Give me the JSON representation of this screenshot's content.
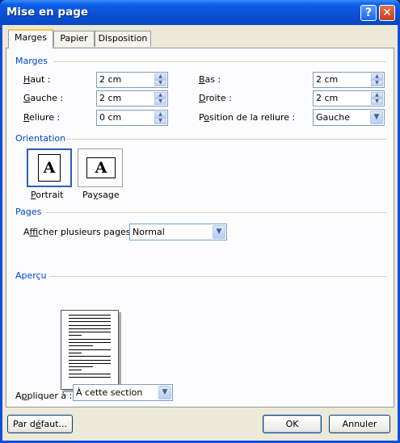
{
  "window": {
    "title": "Mise en page",
    "help_glyph": "?",
    "close_glyph": "✕"
  },
  "tabs": [
    {
      "label": "Marges",
      "active": true
    },
    {
      "label": "Papier",
      "active": false
    },
    {
      "label": "Disposition",
      "active": false
    }
  ],
  "margins": {
    "group_label": "Marges",
    "haut": {
      "mnemonic": "H",
      "rest": "aut :",
      "value": "2 cm"
    },
    "gauche": {
      "mnemonic": "G",
      "rest": "auche :",
      "value": "2 cm"
    },
    "reliure": {
      "mnemonic": "R",
      "rest": "eliure :",
      "value": "0 cm"
    },
    "bas": {
      "mnemonic": "B",
      "rest": "as :",
      "value": "2 cm"
    },
    "droite": {
      "mnemonic": "D",
      "rest": "roite :",
      "value": "2 cm"
    },
    "position": {
      "pre": "P",
      "mnemonic": "o",
      "rest": "sition de la reliure :",
      "value": "Gauche"
    }
  },
  "orientation": {
    "group_label": "Orientation",
    "portrait": {
      "glyph": "A",
      "mnemonic": "P",
      "rest": "ortrait",
      "selected": true
    },
    "paysage": {
      "glyph": "A",
      "pre": "Pa",
      "mnemonic": "y",
      "rest": "sage",
      "selected": false
    }
  },
  "pages": {
    "group_label": "Pages",
    "pre": "A",
    "mnemonic": "f",
    "rest": "ficher plusieurs pages :",
    "value": "Normal"
  },
  "apercu": {
    "group_label": "Aperçu",
    "apply_pre": "A",
    "apply_mnemonic": "p",
    "apply_rest": "pliquer à :",
    "apply_value": "À cette section"
  },
  "buttons": {
    "default_pre": "Par d",
    "default_mnemonic": "é",
    "default_rest": "faut...",
    "ok": "OK",
    "cancel": "Annuler"
  },
  "icons": {
    "spin_up": "▲",
    "spin_down": "▼",
    "dropdown": "▼"
  }
}
